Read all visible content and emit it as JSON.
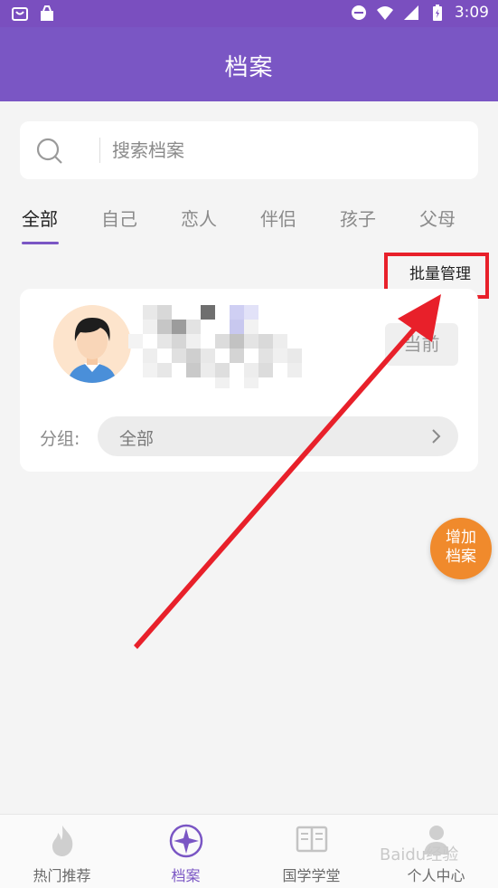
{
  "status_bar": {
    "time": "3:09",
    "icons": [
      "shop-icon",
      "bag-icon",
      "dnd-icon",
      "wifi-icon",
      "signal-icon",
      "battery-icon"
    ]
  },
  "header": {
    "title": "档案"
  },
  "search": {
    "placeholder": "搜索档案",
    "value": ""
  },
  "tabs": [
    {
      "label": "全部",
      "active": true
    },
    {
      "label": "自己"
    },
    {
      "label": "恋人"
    },
    {
      "label": "伴侣"
    },
    {
      "label": "孩子"
    },
    {
      "label": "父母"
    }
  ],
  "batch_manage_label": "批量管理",
  "profile_card": {
    "current_label": "当前",
    "group_label": "分组:",
    "group_value": "全部"
  },
  "fab": {
    "line1": "增加",
    "line2": "档案"
  },
  "bottom_nav": [
    {
      "label": "热门推荐",
      "icon": "flame-icon"
    },
    {
      "label": "档案",
      "icon": "compass-icon",
      "active": true
    },
    {
      "label": "国学学堂",
      "icon": "book-icon"
    },
    {
      "label": "个人中心",
      "icon": "person-icon"
    }
  ],
  "watermark": "Baidu经验",
  "colors": {
    "primary": "#7a56c4",
    "accent_orange": "#f08a2c",
    "annotation_red": "#e8202a"
  }
}
